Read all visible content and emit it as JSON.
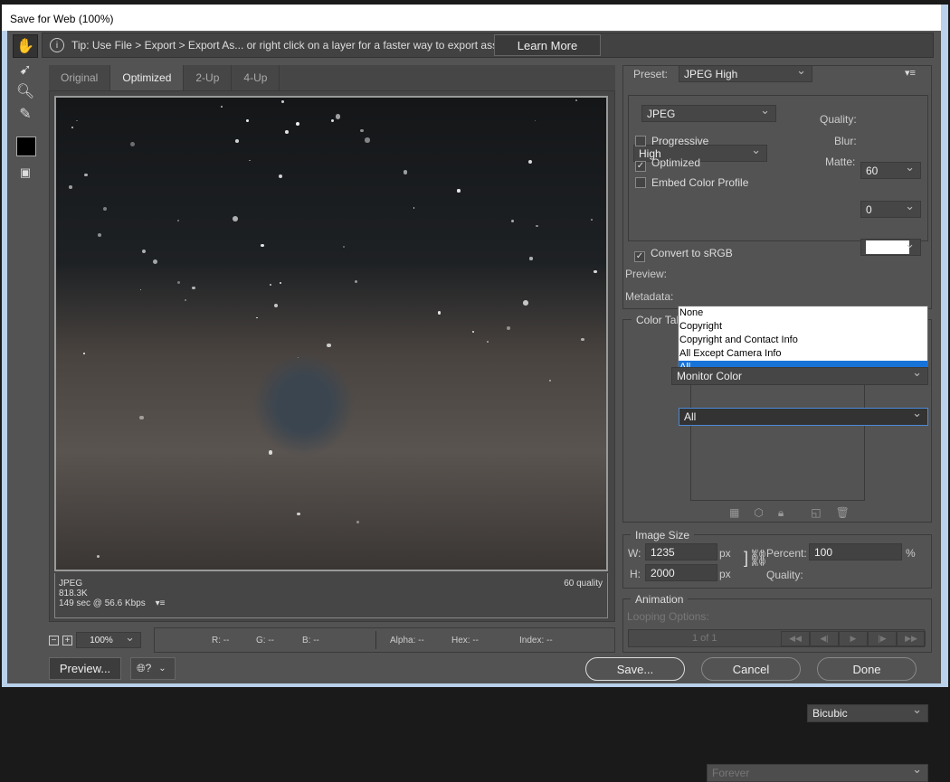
{
  "window": {
    "title": "Save for Web (100%)"
  },
  "tools": [
    {
      "icon": "hand-icon"
    },
    {
      "icon": "slice-select-icon"
    },
    {
      "icon": "zoom-icon"
    },
    {
      "icon": "eyedropper-icon"
    },
    {
      "icon": "eyedropper-color-swatch",
      "color": "#000000"
    },
    {
      "icon": "toggle-slices-icon"
    }
  ],
  "tip": {
    "text": "Tip: Use File > Export > Export As...  or right click on a layer for a faster way to export assets",
    "learn_more": "Learn More"
  },
  "tabs": [
    {
      "label": "Original"
    },
    {
      "label": "Optimized",
      "active": true
    },
    {
      "label": "2-Up"
    },
    {
      "label": "4-Up"
    }
  ],
  "preview_info": {
    "format": "JPEG",
    "size": "818.3K",
    "time": "149 sec @ 56.6 Kbps",
    "quality": "60 quality"
  },
  "zoom": {
    "value": "100%"
  },
  "readout": {
    "r": "R: --",
    "g": "G: --",
    "b": "B: --",
    "alpha": "Alpha: --",
    "hex": "Hex: --",
    "index": "Index: --"
  },
  "buttons": {
    "preview": "Preview...",
    "save": "Save...",
    "cancel": "Cancel",
    "done": "Done"
  },
  "settings": {
    "preset_label": "Preset:",
    "preset": "JPEG High",
    "format": "JPEG",
    "compression": "High",
    "quality_label": "Quality:",
    "quality": "60",
    "blur_label": "Blur:",
    "blur": "0",
    "matte_label": "Matte:",
    "matte_color": "#ffffff",
    "progressive": {
      "label": "Progressive",
      "checked": false
    },
    "optimized": {
      "label": "Optimized",
      "checked": true
    },
    "embed": {
      "label": "Embed Color Profile",
      "checked": false
    },
    "convert": {
      "label": "Convert to sRGB",
      "checked": true
    },
    "preview_label": "Preview:",
    "preview": "Monitor Color",
    "metadata_label": "Metadata:",
    "metadata": "All",
    "metadata_options": [
      "None",
      "Copyright",
      "Copyright and Contact Info",
      "All Except Camera Info",
      "All"
    ]
  },
  "color_table": {
    "label": "Color Tab"
  },
  "image_size": {
    "label": "Image Size",
    "w_label": "W:",
    "w": "1235",
    "h_label": "H:",
    "h": "2000",
    "unit": "px",
    "percent_label": "Percent:",
    "percent": "100",
    "percent_unit": "%",
    "quality_label": "Quality:",
    "quality": "Bicubic"
  },
  "animation": {
    "label": "Animation",
    "looping_label": "Looping Options:",
    "looping": "Forever",
    "frame": "1 of 1"
  }
}
